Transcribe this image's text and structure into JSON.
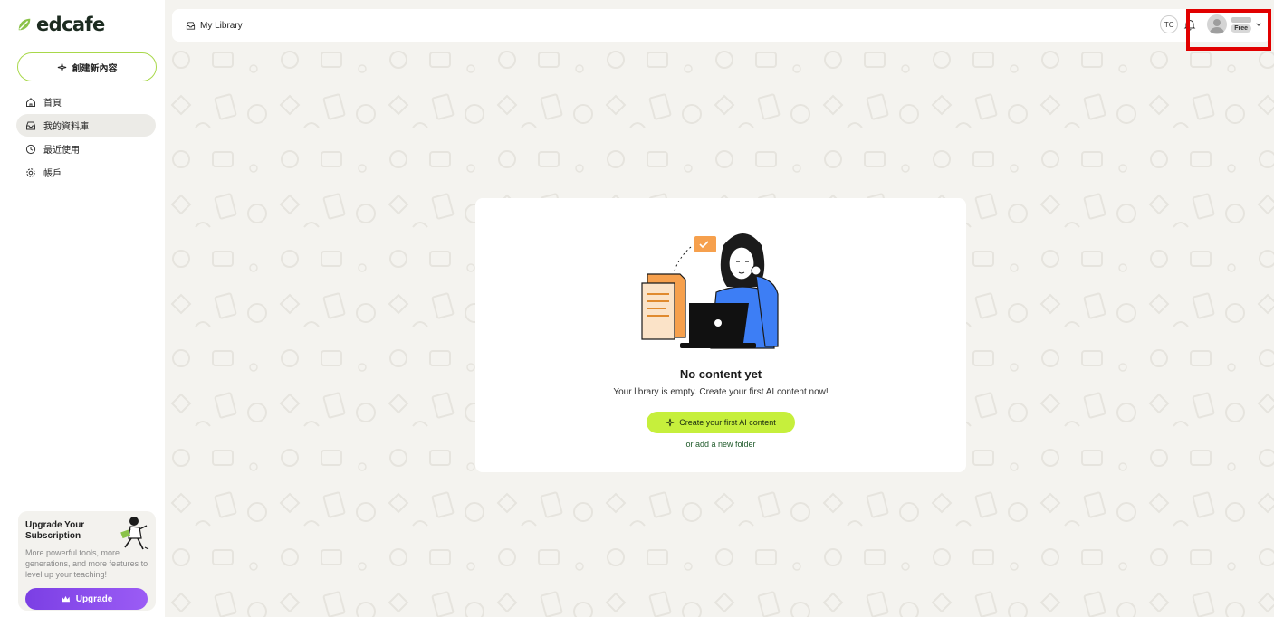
{
  "brand": {
    "name": "edcafe",
    "color": "#8bc34a"
  },
  "sidebar": {
    "create_label": "創建新內容",
    "items": [
      {
        "label": "首頁",
        "icon": "home-icon",
        "active": false
      },
      {
        "label": "我的資料庫",
        "icon": "inbox-icon",
        "active": true
      },
      {
        "label": "最近使用",
        "icon": "clock-icon",
        "active": false
      },
      {
        "label": "帳戶",
        "icon": "gear-icon",
        "active": false
      }
    ],
    "upgrade": {
      "title": "Upgrade Your Subscription",
      "description": "More powerful tools, more generations, and more features to level up your teaching!",
      "button_label": "Upgrade"
    }
  },
  "header": {
    "breadcrumb": "My Library",
    "language": "TC",
    "plan_badge": "Free"
  },
  "empty_state": {
    "title": "No content yet",
    "description": "Your library is empty. Create your first AI content now!",
    "cta_label": "Create your first AI content",
    "secondary_link": "or add a new folder"
  },
  "colors": {
    "accent_lime": "#c6ef3c",
    "upgrade_purple": "#8a4cf0",
    "highlight": "#e10000"
  }
}
